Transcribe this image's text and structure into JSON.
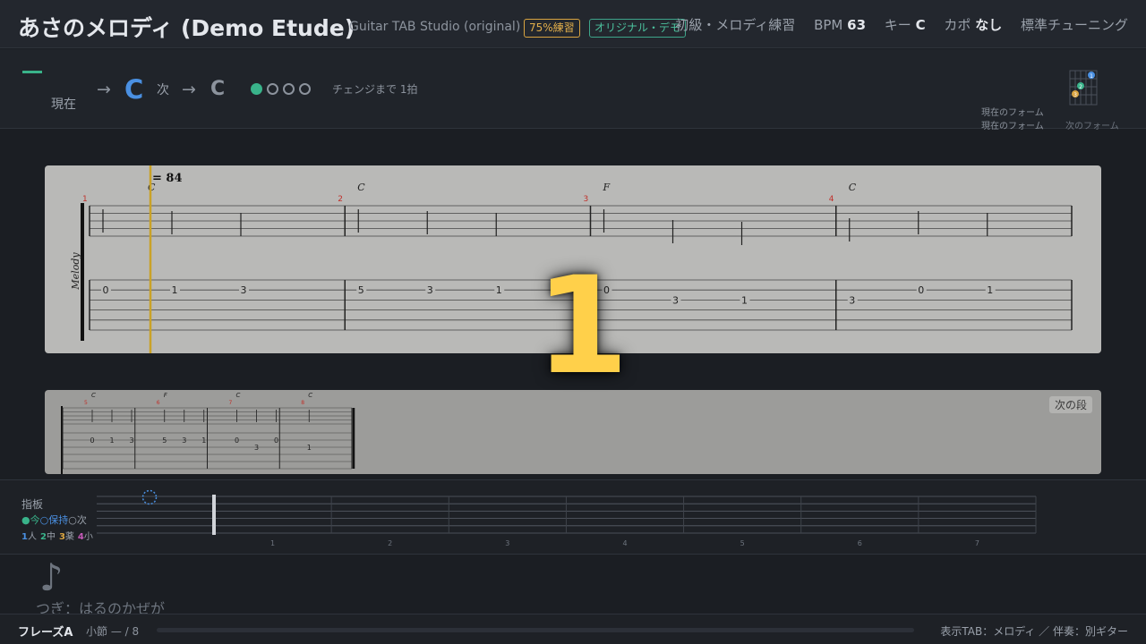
{
  "header": {
    "title": "あさのメロディ (Demo Etude)",
    "subtitle": "Guitar TAB Studio (original)",
    "badge_practice": "75%練習",
    "badge_demo": "オリジナル・デモ",
    "level": "初級・メロディ練習",
    "bpm_label": "BPM",
    "bpm_value": "63",
    "key_label": "キー",
    "key_value": "C",
    "capo_label": "カポ",
    "capo_value": "なし",
    "tuning": "標準チューニング"
  },
  "chord_bar": {
    "current_label": "現在",
    "arrow": "→",
    "chord_current": "C",
    "next_label": "次",
    "chord_next": "C",
    "beats_total": 4,
    "beats_on": 1,
    "change_text": "チェンジまで 1拍",
    "form_current": "現在のフォーム",
    "form_next": "次のフォーム",
    "diagram_fingers": [
      "1",
      "2",
      "3"
    ]
  },
  "colors": {
    "accent_blue": "#4a90e2",
    "accent_green": "#39b38a",
    "countdown": "#ffd04a",
    "finger1": "#4a90e2",
    "finger2": "#39b38a",
    "finger3": "#d9a441",
    "finger4": "#c55ab8",
    "bar_number": "#c0302a"
  },
  "tab": {
    "tempo_text": "= 84",
    "track_label": "Melody",
    "cursor_fraction": 0.0,
    "measures": [
      {
        "number": "1",
        "chord": "C",
        "stems": [
          0,
          1,
          2
        ],
        "notes": [
          {
            "fret": "0",
            "string": 2
          },
          {
            "fret": "1",
            "string": 2
          },
          {
            "fret": "3",
            "string": 2
          }
        ]
      },
      {
        "number": "2",
        "chord": "C",
        "stems": [
          0,
          1,
          2
        ],
        "notes": [
          {
            "fret": "5",
            "string": 2
          },
          {
            "fret": "3",
            "string": 2
          },
          {
            "fret": "1",
            "string": 2
          }
        ]
      },
      {
        "number": "3",
        "chord": "F",
        "stems": [
          0,
          1,
          2
        ],
        "notes": [
          {
            "fret": "0",
            "string": 2
          },
          {
            "fret": "3",
            "string": 3
          },
          {
            "fret": "1",
            "string": 3
          }
        ]
      },
      {
        "number": "4",
        "chord": "C",
        "stems": [
          0,
          1,
          2
        ],
        "notes": [
          {
            "fret": "3",
            "string": 3
          },
          {
            "fret": "0",
            "string": 2
          },
          {
            "fret": "1",
            "string": 2
          }
        ]
      }
    ],
    "next_row_label": "次の段",
    "next_measures": [
      {
        "number": "5",
        "chord": "C",
        "notes": [
          {
            "fret": "0",
            "string": 2
          },
          {
            "fret": "1",
            "string": 2
          },
          {
            "fret": "3",
            "string": 2
          }
        ]
      },
      {
        "number": "6",
        "chord": "F",
        "notes": [
          {
            "fret": "5",
            "string": 2
          },
          {
            "fret": "3",
            "string": 2
          },
          {
            "fret": "1",
            "string": 2
          }
        ]
      },
      {
        "number": "7",
        "chord": "C",
        "notes": [
          {
            "fret": "0",
            "string": 2
          },
          {
            "fret": "3",
            "string": 3
          },
          {
            "fret": "0",
            "string": 2
          }
        ]
      },
      {
        "number": "8",
        "chord": "C",
        "notes": [
          {
            "fret": "1",
            "string": 3
          }
        ]
      }
    ]
  },
  "countdown": "1",
  "fretboard": {
    "label": "指板",
    "legend_now": "●今",
    "legend_hold": "○保持",
    "legend_next": "○次",
    "legend_fingers": [
      {
        "num": "1",
        "name": "人"
      },
      {
        "num": "2",
        "name": "中"
      },
      {
        "num": "3",
        "name": "薬"
      },
      {
        "num": "4",
        "name": "小"
      }
    ],
    "fret_numbers": [
      "1",
      "2",
      "3",
      "4",
      "5",
      "6",
      "7"
    ],
    "marker_string": 1,
    "marker_fret": 0
  },
  "lyric": {
    "note_icon": "♪",
    "next_text": "つぎ：はるのかぜが"
  },
  "footer": {
    "phrase": "フレーズA",
    "measure_text": "小節 — / 8",
    "progress": 0.0,
    "display_tab": "表示TAB：メロディ ／ 伴奏：別ギター"
  }
}
